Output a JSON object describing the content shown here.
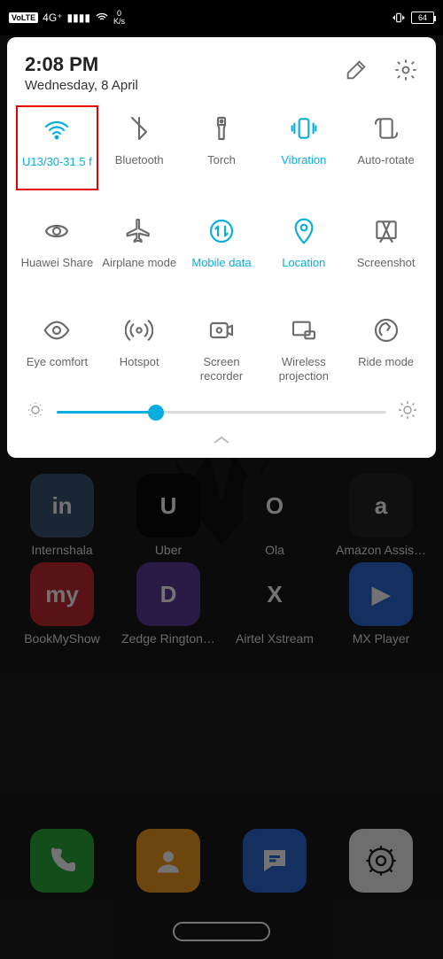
{
  "status": {
    "volte": "VoLTE",
    "sig": "4G⁺",
    "speed_num": "0",
    "speed_unit": "K/s",
    "battery": "64"
  },
  "panel": {
    "time": "2:08 PM",
    "date": "Wednesday, 8 April"
  },
  "tiles": [
    {
      "name": "wifi",
      "label": "U13/30-31 5 f",
      "active": true,
      "highlight": true,
      "icon": "wifi"
    },
    {
      "name": "bluetooth",
      "label": "Bluetooth",
      "active": false,
      "icon": "bluetooth"
    },
    {
      "name": "torch",
      "label": "Torch",
      "active": false,
      "icon": "torch"
    },
    {
      "name": "vibration",
      "label": "Vibration",
      "active": true,
      "icon": "vibration"
    },
    {
      "name": "autorotate",
      "label": "Auto-rotate",
      "active": false,
      "icon": "autorotate"
    },
    {
      "name": "huaweishare",
      "label": "Huawei Share",
      "active": false,
      "icon": "share"
    },
    {
      "name": "airplane",
      "label": "Airplane mode",
      "active": false,
      "icon": "airplane"
    },
    {
      "name": "mobiledata",
      "label": "Mobile data",
      "active": true,
      "icon": "data"
    },
    {
      "name": "location",
      "label": "Location",
      "active": true,
      "icon": "location"
    },
    {
      "name": "screenshot",
      "label": "Screenshot",
      "active": false,
      "icon": "screenshot"
    },
    {
      "name": "eyecomfort",
      "label": "Eye comfort",
      "active": false,
      "icon": "eye"
    },
    {
      "name": "hotspot",
      "label": "Hotspot",
      "active": false,
      "icon": "hotspot"
    },
    {
      "name": "screenrecorder",
      "label": "Screen recorder",
      "active": false,
      "icon": "recorder"
    },
    {
      "name": "wirelessprojection",
      "label": "Wireless projection",
      "active": false,
      "icon": "projection"
    },
    {
      "name": "ridemode",
      "label": "Ride mode",
      "active": false,
      "icon": "ride"
    }
  ],
  "brightness": {
    "percent": 30
  },
  "desktop": {
    "row_top": [
      {
        "label": "Internshala",
        "color": "#3b5572",
        "text": "in"
      },
      {
        "label": "Uber",
        "color": "#0a0a0a",
        "text": "U"
      },
      {
        "label": "Ola",
        "color": "#1a1a1a",
        "text": "O"
      },
      {
        "label": "Amazon Assis…",
        "color": "#252525",
        "text": "a"
      }
    ],
    "row_mid": [
      {
        "label": "BookMyShow",
        "color": "#c5282f",
        "text": "my"
      },
      {
        "label": "Zedge Rington…",
        "color": "#5b3a9c",
        "text": "D"
      },
      {
        "label": "Airtel Xstream",
        "color": "#191919",
        "text": "X"
      },
      {
        "label": "MX Player",
        "color": "#2b6bd8",
        "text": "▶"
      }
    ],
    "dock": [
      {
        "label": "",
        "color": "#2bab3f",
        "svg": "phone"
      },
      {
        "label": "",
        "color": "#f29b1d",
        "svg": "contact"
      },
      {
        "label": "",
        "color": "#2b6bd8",
        "svg": "message"
      },
      {
        "label": "",
        "color": "#f4f4f4",
        "svg": "gear-dark"
      }
    ]
  }
}
